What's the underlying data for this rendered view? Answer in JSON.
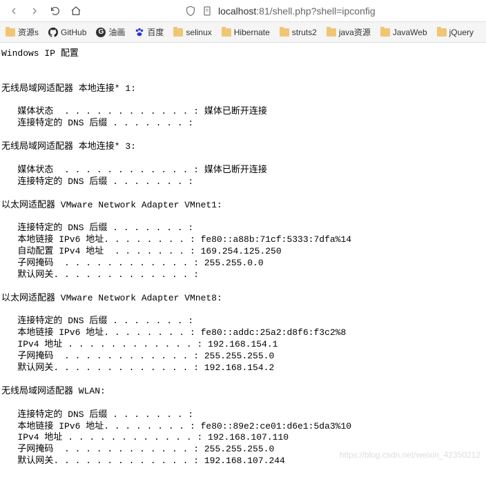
{
  "nav": {
    "url_prefix": "localhost",
    "url_suffix": ":81/shell.php?shell=ipconfig"
  },
  "bookmarks": [
    {
      "label": "资源s",
      "type": "folder"
    },
    {
      "label": "GitHub",
      "type": "github"
    },
    {
      "label": "油画",
      "type": "oil"
    },
    {
      "label": "百度",
      "type": "baidu"
    },
    {
      "label": "selinux",
      "type": "folder"
    },
    {
      "label": "Hibernate",
      "type": "folder"
    },
    {
      "label": "struts2",
      "type": "folder"
    },
    {
      "label": "java资源",
      "type": "folder"
    },
    {
      "label": "JavaWeb",
      "type": "folder"
    },
    {
      "label": "jQuery",
      "type": "folder"
    }
  ],
  "output": {
    "title": "Windows IP 配置",
    "sections": [
      {
        "header": "无线局域网适配器 本地连接* 1:",
        "lines": [
          {
            "label": "媒体状态",
            "dots": "  . . . . . . . . . . . . :",
            "value": " 媒体已断开连接"
          },
          {
            "label": "连接特定的 DNS 后缀",
            "dots": " . . . . . . . :",
            "value": ""
          }
        ]
      },
      {
        "header": "无线局域网适配器 本地连接* 3:",
        "lines": [
          {
            "label": "媒体状态",
            "dots": "  . . . . . . . . . . . . :",
            "value": " 媒体已断开连接"
          },
          {
            "label": "连接特定的 DNS 后缀",
            "dots": " . . . . . . . :",
            "value": ""
          }
        ]
      },
      {
        "header": "以太网适配器 VMware Network Adapter VMnet1:",
        "lines": [
          {
            "label": "连接特定的 DNS 后缀",
            "dots": " . . . . . . . :",
            "value": ""
          },
          {
            "label": "本地链接 IPv6 地址",
            "dots": ". . . . . . . . :",
            "value": " fe80::a88b:71cf:5333:7dfa%14"
          },
          {
            "label": "自动配置 IPv4 地址",
            "dots": "  . . . . . . . :",
            "value": " 169.254.125.250"
          },
          {
            "label": "子网掩码",
            "dots": "  . . . . . . . . . . . . :",
            "value": " 255.255.0.0"
          },
          {
            "label": "默认网关",
            "dots": ". . . . . . . . . . . . . :",
            "value": ""
          }
        ]
      },
      {
        "header": "以太网适配器 VMware Network Adapter VMnet8:",
        "lines": [
          {
            "label": "连接特定的 DNS 后缀",
            "dots": " . . . . . . . :",
            "value": ""
          },
          {
            "label": "本地链接 IPv6 地址",
            "dots": ". . . . . . . . :",
            "value": " fe80::addc:25a2:d8f6:f3c2%8"
          },
          {
            "label": "IPv4 地址",
            "dots": " . . . . . . . . . . . . :",
            "value": " 192.168.154.1"
          },
          {
            "label": "子网掩码",
            "dots": "  . . . . . . . . . . . . :",
            "value": " 255.255.255.0"
          },
          {
            "label": "默认网关",
            "dots": ". . . . . . . . . . . . . :",
            "value": " 192.168.154.2"
          }
        ]
      },
      {
        "header": "无线局域网适配器 WLAN:",
        "lines": [
          {
            "label": "连接特定的 DNS 后缀",
            "dots": " . . . . . . . :",
            "value": ""
          },
          {
            "label": "本地链接 IPv6 地址",
            "dots": ". . . . . . . . :",
            "value": " fe80::89e2:ce01:d6e1:5da3%10"
          },
          {
            "label": "IPv4 地址",
            "dots": " . . . . . . . . . . . . :",
            "value": " 192.168.107.110"
          },
          {
            "label": "子网掩码",
            "dots": "  . . . . . . . . . . . . :",
            "value": " 255.255.255.0"
          },
          {
            "label": "默认网关",
            "dots": ". . . . . . . . . . . . . :",
            "value": " 192.168.107.244"
          }
        ]
      }
    ]
  },
  "watermark": "https://blog.csdn.net/weixin_42350212"
}
